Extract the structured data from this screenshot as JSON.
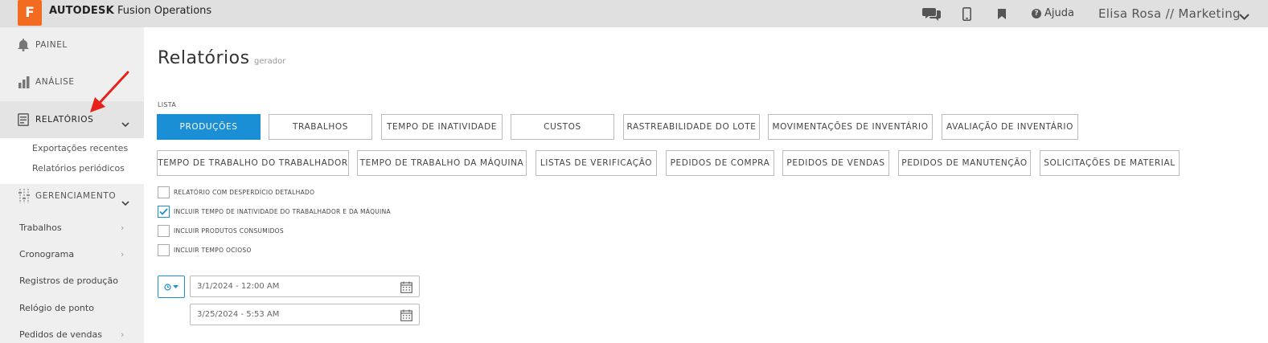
{
  "app": {
    "logo_letter": "F",
    "brand_bold": "AUTODESK",
    "brand_rest": "Fusion Operations",
    "help_label": "Ajuda",
    "user_label": "Elisa Rosa // Marketing"
  },
  "sidebar": {
    "painel": "PAINEL",
    "analise": "ANÁLISE",
    "relatorios": "RELATÓRIOS",
    "sub_links": [
      "Exportações recentes",
      "Relatórios periódicos"
    ],
    "gerenciamento": "GERENCIAMENTO",
    "mgmt_items": [
      "Trabalhos",
      "Cronograma",
      "Registros de produção",
      "Relógio de ponto",
      "Pedidos de vendas"
    ]
  },
  "main": {
    "title": "Relatórios",
    "subtitle": "gerador",
    "list_label": "LISTA",
    "buttons_row1": [
      "PRODUÇÕES",
      "TRABALHOS",
      "TEMPO DE INATIVIDADE",
      "CUSTOS",
      "RASTREABILIDADE DO LOTE",
      "MOVIMENTAÇÕES DE INVENTÁRIO",
      "AVALIAÇÃO DE INVENTÁRIO"
    ],
    "buttons_row2": [
      "TEMPO DE TRABALHO DO TRABALHADOR",
      "TEMPO DE TRABALHO DA MÁQUINA",
      "LISTAS DE VERIFICAÇÃO",
      "PEDIDOS DE COMPRA",
      "PEDIDOS DE VENDAS",
      "PEDIDOS DE MANUTENÇÃO",
      "SOLICITAÇÕES DE MATERIAL"
    ],
    "active_button": "PRODUÇÕES",
    "checkboxes": [
      {
        "label": "RELATÓRIO COM DESPERDÍCIO DETALHADO",
        "checked": false
      },
      {
        "label": "INCLUIR TEMPO DE INATIVIDADE DO TRABALHADOR E DA MÁQUINA",
        "checked": true
      },
      {
        "label": "INCLUIR PRODUTOS CONSUMIDOS",
        "checked": false
      },
      {
        "label": "INCLUIR TEMPO OCIOSO",
        "checked": false
      }
    ],
    "date_start": "3/1/2024 - 12:00 AM",
    "date_end": "3/25/2024 - 5:53 AM"
  },
  "colors": {
    "accent": "#1a8fd6",
    "logo": "#f36b21",
    "annotation_arrow": "#e8201a"
  }
}
